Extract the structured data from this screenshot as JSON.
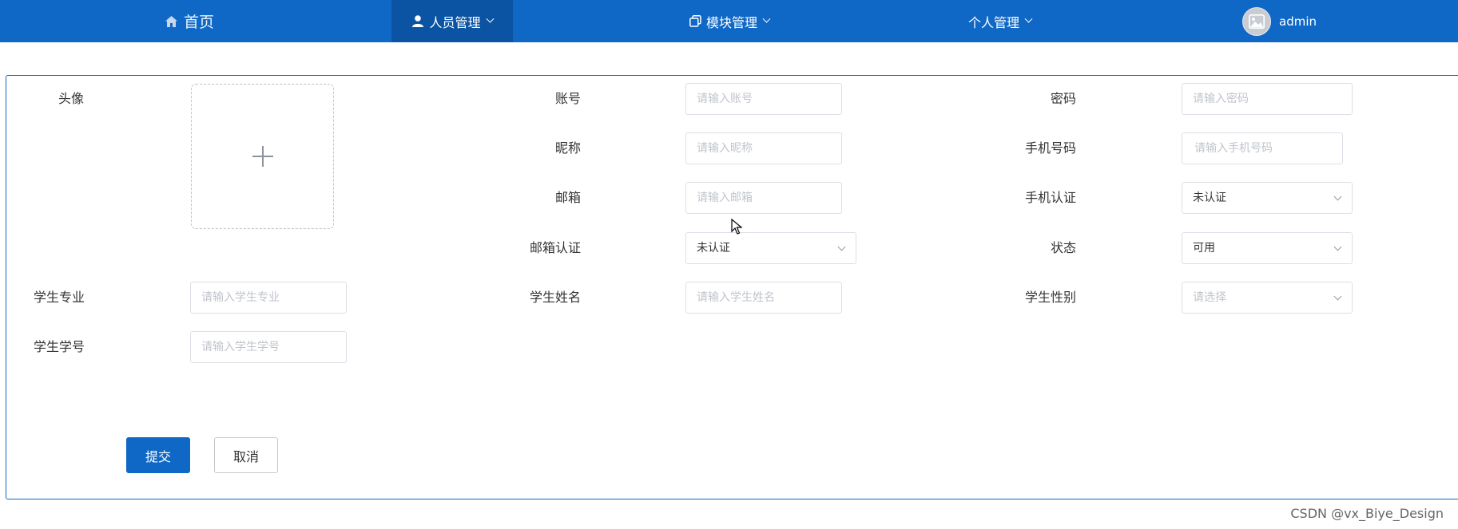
{
  "nav": {
    "home_label": "首页",
    "people_label": "人员管理",
    "module_label": "模块管理",
    "personal_label": "个人管理",
    "username": "admin"
  },
  "form": {
    "avatar_label": "头像",
    "account_label": "账号",
    "account_placeholder": "请输入账号",
    "password_label": "密码",
    "password_placeholder": "请输入密码",
    "nickname_label": "昵称",
    "nickname_placeholder": "请输入昵称",
    "phone_label": "手机号码",
    "phone_placeholder": "请输入手机号码",
    "email_label": "邮箱",
    "email_placeholder": "请输入邮箱",
    "phone_verify_label": "手机认证",
    "phone_verify_value": "未认证",
    "email_verify_label": "邮箱认证",
    "email_verify_value": "未认证",
    "status_label": "状态",
    "status_value": "可用",
    "major_label": "学生专业",
    "major_placeholder": "请输入学生专业",
    "student_name_label": "学生姓名",
    "student_name_placeholder": "请输入学生姓名",
    "gender_label": "学生性别",
    "gender_placeholder": "请选择",
    "student_id_label": "学生学号",
    "student_id_placeholder": "请输入学生学号",
    "submit_label": "提交",
    "cancel_label": "取消"
  },
  "watermark": "CSDN @vx_Biye_Design",
  "colors": {
    "primary": "#1068c6",
    "nav_active": "#0b53a3"
  }
}
